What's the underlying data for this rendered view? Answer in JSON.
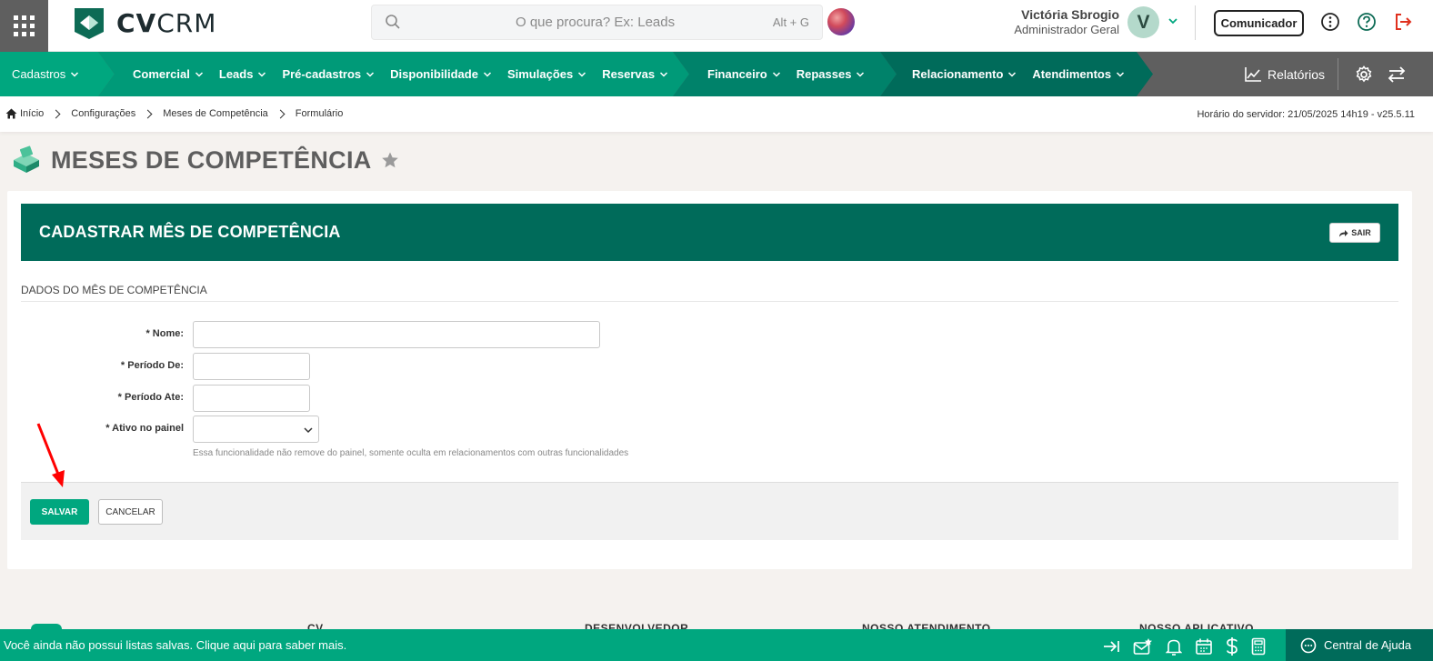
{
  "header": {
    "logo_text_bold": "CV",
    "logo_text_light": "CRM",
    "search_placeholder": "O que procura? Ex: Leads",
    "search_shortcut": "Alt + G",
    "user_name": "Victória Sbrogio",
    "user_role": "Administrador Geral",
    "avatar_initial": "V",
    "comunicador_label": "Comunicador"
  },
  "nav": {
    "groups": [
      {
        "items": [
          {
            "label": "Cadastros"
          }
        ]
      },
      {
        "items": [
          {
            "label": "Comercial"
          },
          {
            "label": "Leads"
          },
          {
            "label": "Pré-cadastros"
          },
          {
            "label": "Disponibilidade"
          },
          {
            "label": "Simulações"
          },
          {
            "label": "Reservas"
          }
        ]
      },
      {
        "items": [
          {
            "label": "Financeiro"
          },
          {
            "label": "Repasses"
          }
        ]
      },
      {
        "items": [
          {
            "label": "Relacionamento"
          },
          {
            "label": "Atendimentos"
          }
        ]
      }
    ],
    "relatorios_label": "Relatórios"
  },
  "breadcrumb": {
    "items": [
      "Início",
      "Configurações",
      "Meses de Competência",
      "Formulário"
    ],
    "server_time": "Horário do servidor: 21/05/2025 14h19 - v25.5.11"
  },
  "page": {
    "title": "MESES DE COMPETÊNCIA"
  },
  "form": {
    "card_title": "CADASTRAR MÊS DE COMPETÊNCIA",
    "exit_label": "SAIR",
    "section_title": "DADOS DO MÊS DE COMPETÊNCIA",
    "fields": {
      "nome": {
        "label": "* Nome:",
        "value": ""
      },
      "periodo_de": {
        "label": "* Período De:",
        "value": ""
      },
      "periodo_ate": {
        "label": "* Período Ate:",
        "value": ""
      },
      "ativo_painel": {
        "label": "* Ativo no painel",
        "value": ""
      }
    },
    "help_text": "Essa funcionalidade não remove do painel, somente oculta em relacionamentos com outras funcionalidades",
    "save_label": "SALVAR",
    "cancel_label": "CANCELAR"
  },
  "footer": {
    "columns": [
      "CV",
      "DESENVOLVEDOR",
      "NOSSO ATENDIMENTO",
      "NOSSO APLICATIVO"
    ]
  },
  "statusbar": {
    "message": "Você ainda não possui listas salvas. Clique aqui para saber mais.",
    "help_center_label": "Central de Ajuda"
  },
  "colors": {
    "brand_green": "#00a77f",
    "dark_green": "#006b5a",
    "nav_gray": "#5f5f5f",
    "logout_red": "#e0301e",
    "annotation_red": "#ff0000"
  }
}
